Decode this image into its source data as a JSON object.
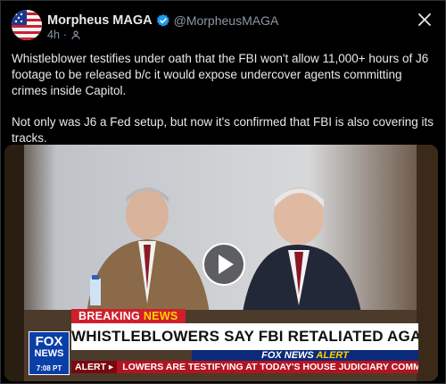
{
  "tweet": {
    "display_name": "Morpheus MAGA",
    "handle": "@MorpheusMAGA",
    "timestamp": "4h",
    "separator": "·",
    "paragraphs": [
      "Whistleblower testifies under oath that the FBI won't allow 11,000+ hours of J6 footage to be released b/c it would expose undercover agents committing crimes inside Capitol.",
      "Not only was J6 a Fed setup, but now it's confirmed that FBI is also covering its tracks."
    ]
  },
  "video": {
    "breaking_label": "BREAKING",
    "breaking_news_word": "NEWS",
    "headline": "WHISTLEBLOWERS SAY FBI RETALIATED AGAINST THEM",
    "network_label": "FOX NEWS",
    "network_alert_word": "ALERT",
    "logo_top": "FOX",
    "logo_bottom": "NEWS",
    "clock": "7:08 PT",
    "ticker_tag": "ALERT ▸",
    "ticker_text": "LOWERS ARE TESTIFYING AT TODAY'S HOUSE JUDICIARY COMMITTEE HEARING"
  },
  "icons": {
    "verified": "verified-badge-icon",
    "audience": "globe-icon",
    "close": "close-icon",
    "play": "play-icon"
  },
  "colors": {
    "background": "#000000",
    "text": "#e7e9ea",
    "muted": "#8b98a5",
    "verified": "#1d9bf0",
    "breaking_red": "#cf1f2a",
    "fox_blue": "#0b2a7a"
  }
}
